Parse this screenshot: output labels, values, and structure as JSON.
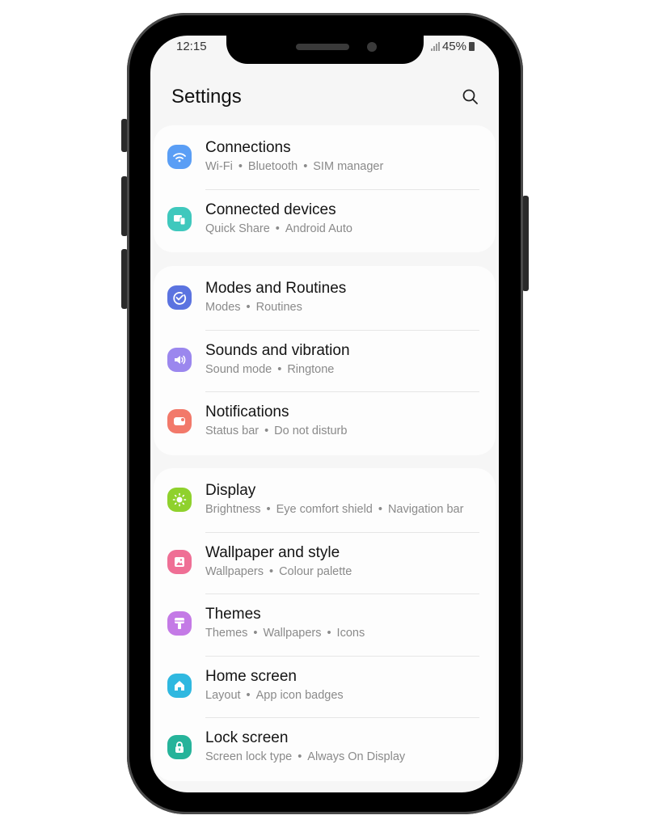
{
  "status_bar": {
    "time": "12:15",
    "battery": "45%"
  },
  "header": {
    "title": "Settings",
    "search_icon": "search-icon"
  },
  "groups": [
    {
      "items": [
        {
          "title": "Connections",
          "subs": [
            "Wi-Fi",
            "Bluetooth",
            "SIM manager"
          ],
          "icon": "wifi-icon",
          "color": "#5a9ef5"
        },
        {
          "title": "Connected devices",
          "subs": [
            "Quick Share",
            "Android Auto"
          ],
          "icon": "devices-icon",
          "color": "#3fc8bd"
        }
      ]
    },
    {
      "items": [
        {
          "title": "Modes and Routines",
          "subs": [
            "Modes",
            "Routines"
          ],
          "icon": "check-circle-icon",
          "color": "#5b73e0"
        },
        {
          "title": "Sounds and vibration",
          "subs": [
            "Sound mode",
            "Ringtone"
          ],
          "icon": "speaker-icon",
          "color": "#9b87ee"
        },
        {
          "title": "Notifications",
          "subs": [
            "Status bar",
            "Do not disturb"
          ],
          "icon": "notification-icon",
          "color": "#f2796a"
        }
      ]
    },
    {
      "items": [
        {
          "title": "Display",
          "subs": [
            "Brightness",
            "Eye comfort shield",
            "Navigation bar"
          ],
          "icon": "sun-icon",
          "color": "#8fd12d"
        },
        {
          "title": "Wallpaper and style",
          "subs": [
            "Wallpapers",
            "Colour palette"
          ],
          "icon": "image-icon",
          "color": "#ef6f95"
        },
        {
          "title": "Themes",
          "subs": [
            "Themes",
            "Wallpapers",
            "Icons"
          ],
          "icon": "brush-icon",
          "color": "#c47ae6"
        },
        {
          "title": "Home screen",
          "subs": [
            "Layout",
            "App icon badges"
          ],
          "icon": "home-icon",
          "color": "#2fb8e0"
        },
        {
          "title": "Lock screen",
          "subs": [
            "Screen lock type",
            "Always On Display"
          ],
          "icon": "lock-icon",
          "color": "#26b39a"
        }
      ]
    }
  ]
}
